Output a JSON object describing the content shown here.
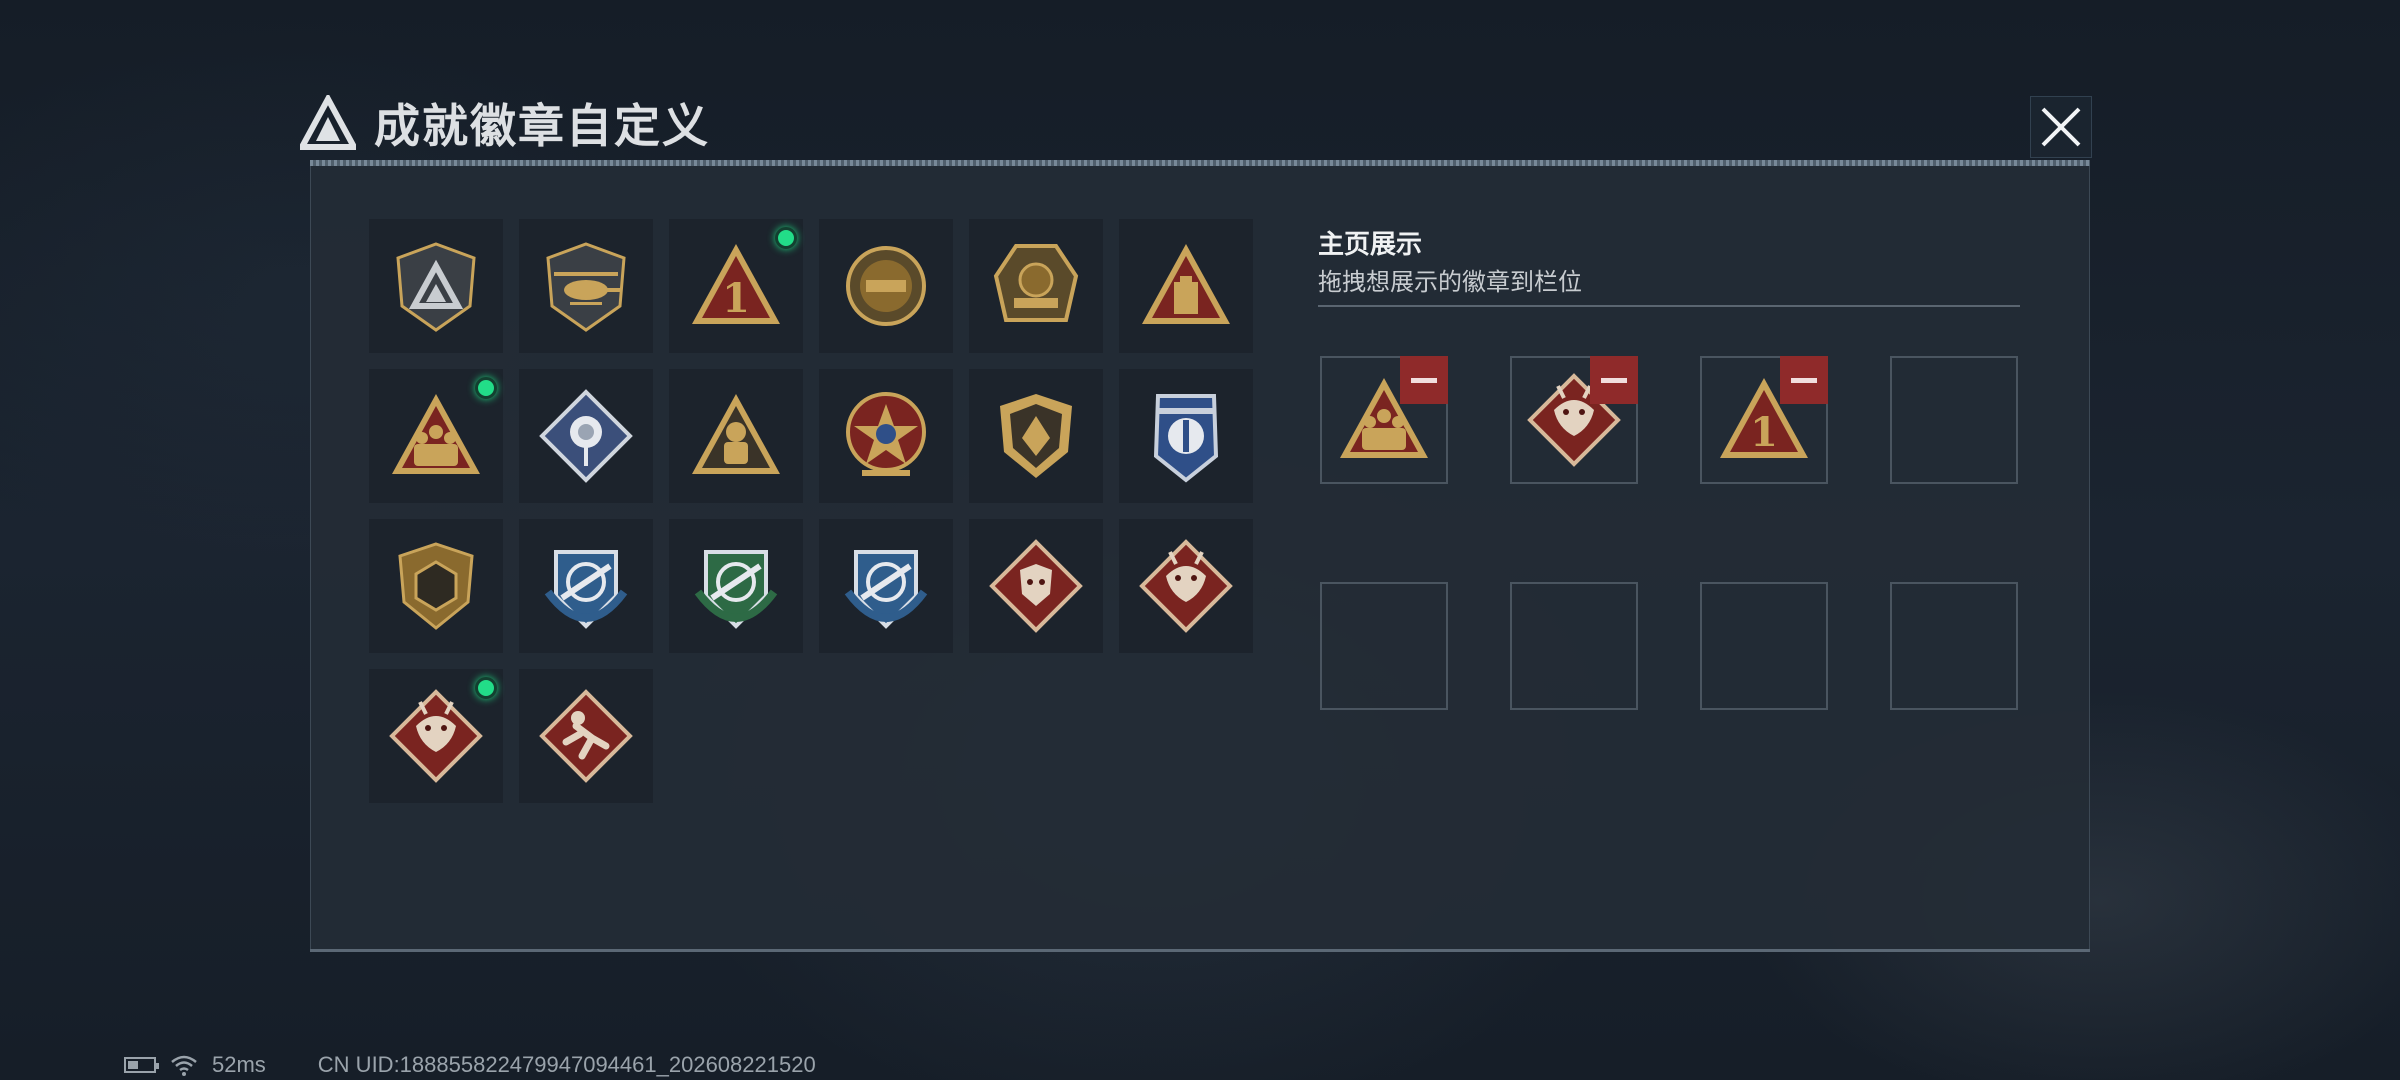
{
  "header": {
    "title": "成就徽章自定义",
    "logo_icon": "delta-logo-icon",
    "close_icon": "close-icon"
  },
  "badges": [
    {
      "icon": "delta-shield-badge",
      "new": false
    },
    {
      "icon": "helicopter-badge",
      "new": false
    },
    {
      "icon": "rank-one-triangle-badge",
      "new": true
    },
    {
      "icon": "delta-force-emblem-badge",
      "new": false
    },
    {
      "icon": "delta-force-2026-badge",
      "new": false
    },
    {
      "icon": "tower-triangle-badge",
      "new": false
    },
    {
      "icon": "squad-triangle-badge",
      "new": true
    },
    {
      "icon": "rose-diamond-badge",
      "new": false
    },
    {
      "icon": "astronaut-triangle-badge",
      "new": false
    },
    {
      "icon": "star-medal-badge",
      "new": false
    },
    {
      "icon": "gold-shield-badge",
      "new": false
    },
    {
      "icon": "blue-eagle-shield-badge",
      "new": false
    },
    {
      "icon": "hex-shield-badge",
      "new": false
    },
    {
      "icon": "blue-rifle-shield-badge",
      "new": false
    },
    {
      "icon": "green-rifle-shield-badge",
      "new": false
    },
    {
      "icon": "blue-knife-shield-badge",
      "new": false
    },
    {
      "icon": "wolf-diamond-badge",
      "new": false
    },
    {
      "icon": "dragon-diamond-badge",
      "new": false
    },
    {
      "icon": "dragon-diamond-badge-2",
      "new": true
    },
    {
      "icon": "runner-diamond-badge",
      "new": false
    }
  ],
  "display": {
    "title": "主页展示",
    "subtitle": "拖拽想展示的徽章到栏位",
    "slots": [
      {
        "icon": "squad-triangle-badge",
        "filled": true
      },
      {
        "icon": "dragon-diamond-badge",
        "filled": true
      },
      {
        "icon": "rank-one-triangle-badge",
        "filled": true
      },
      {
        "icon": "",
        "filled": false
      },
      {
        "icon": "",
        "filled": false
      },
      {
        "icon": "",
        "filled": false
      },
      {
        "icon": "",
        "filled": false
      },
      {
        "icon": "",
        "filled": false
      }
    ],
    "remove_icon": "minus-icon"
  },
  "status": {
    "battery_icon": "battery-icon",
    "wifi_icon": "wifi-icon",
    "ping": "52ms",
    "uid": "CN UID:1888558224799470944​61_202608221520"
  },
  "colors": {
    "accent_new": "#22dd88",
    "remove": "#8f2a2a",
    "gold": "#c9a45a",
    "crimson": "#7a2420"
  }
}
